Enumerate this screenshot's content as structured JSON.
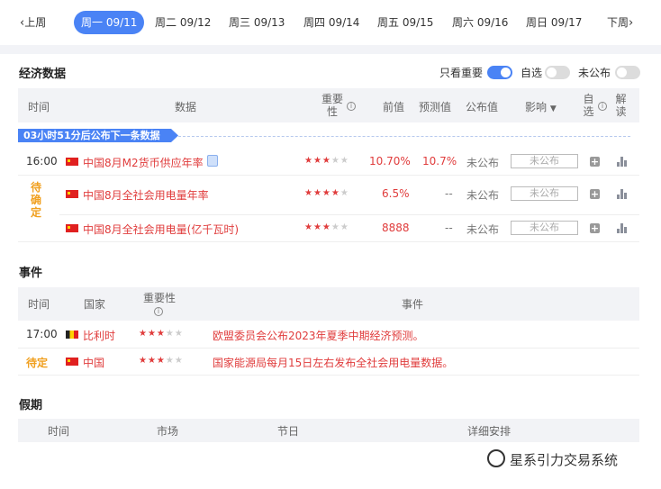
{
  "week_nav": {
    "prev_label": "上周",
    "next_label": "下周",
    "days": [
      {
        "label": "周一 09/11",
        "active": true
      },
      {
        "label": "周二 09/12",
        "active": false
      },
      {
        "label": "周三 09/13",
        "active": false
      },
      {
        "label": "周四 09/14",
        "active": false
      },
      {
        "label": "周五 09/15",
        "active": false
      },
      {
        "label": "周六 09/16",
        "active": false
      },
      {
        "label": "周日 09/17",
        "active": false
      }
    ]
  },
  "econ": {
    "title": "经济数据",
    "filters": {
      "important_only": {
        "label": "只看重要",
        "on": true
      },
      "self_selected": {
        "label": "自选",
        "on": false
      },
      "unpublished": {
        "label": "未公布",
        "on": false
      }
    },
    "columns": {
      "time": "时间",
      "data": "数据",
      "importance": "重要性",
      "previous": "前值",
      "forecast": "预测值",
      "actual": "公布值",
      "impact": "影响",
      "watch": "自选",
      "interpret": "解读"
    },
    "countdown_banner": "03小时51分后公布下一条数据",
    "rows": [
      {
        "time": "16:00",
        "name": "中国8月M2货币供应年率",
        "stars": 3,
        "previous": "10.70%",
        "forecast": "10.7%",
        "actual": "未公布",
        "impact": "未公布"
      },
      {
        "time": "待确定",
        "name": "中国8月全社会用电量年率",
        "stars": 4,
        "previous": "6.5%",
        "forecast": "--",
        "actual": "未公布",
        "impact": "未公布"
      },
      {
        "time": "",
        "name": "中国8月全社会用电量(亿千瓦时)",
        "stars": 3,
        "previous": "8888",
        "forecast": "--",
        "actual": "未公布",
        "impact": "未公布"
      }
    ]
  },
  "events": {
    "title": "事件",
    "columns": {
      "time": "时间",
      "country": "国家",
      "importance": "重要性",
      "event": "事件"
    },
    "rows": [
      {
        "time": "17:00",
        "country": "比利时",
        "flag": "be",
        "stars": 3,
        "event": "欧盟委员会公布2023年夏季中期经济预测。"
      },
      {
        "time": "待定",
        "country": "中国",
        "flag": "cn",
        "stars": 3,
        "event": "国家能源局每月15日左右发布全社会用电量数据。"
      }
    ]
  },
  "holidays": {
    "title": "假期",
    "columns": {
      "time": "时间",
      "market": "市场",
      "holiday": "节日",
      "details": "详细安排"
    }
  },
  "watermark": {
    "text": "星系引力交易系统"
  },
  "colors": {
    "accent": "#4a83f5",
    "red": "#e03c3c",
    "orange": "#f0a020",
    "header_bg": "#f2f3f6"
  }
}
